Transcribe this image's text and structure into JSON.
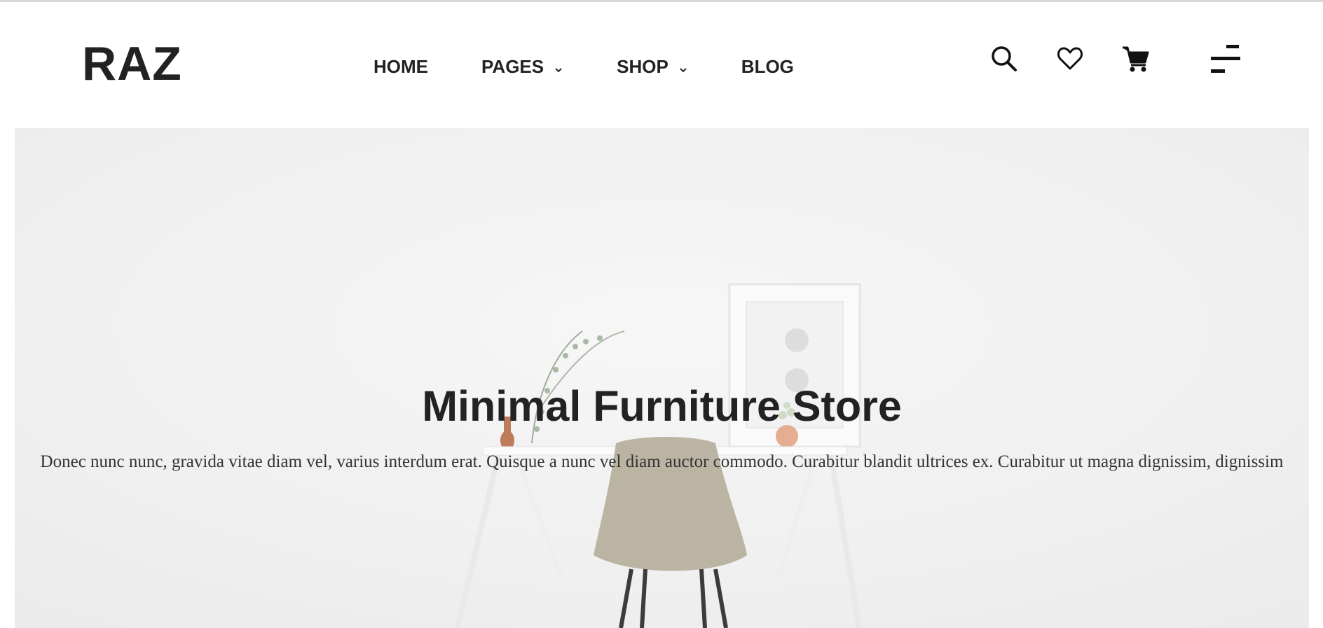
{
  "brand": {
    "logo": "RAZ"
  },
  "nav": {
    "items": [
      {
        "label": "HOME",
        "has_dropdown": false
      },
      {
        "label": "PAGES",
        "has_dropdown": true
      },
      {
        "label": "SHOP",
        "has_dropdown": true
      },
      {
        "label": "BLOG",
        "has_dropdown": false
      }
    ]
  },
  "header_icons": [
    "search-icon",
    "heart-icon",
    "cart-icon",
    "menu-icon"
  ],
  "hero": {
    "title": "Minimal Furniture Store",
    "text": "Donec nunc nunc, gravida vitae diam vel, varius interdum erat. Quisque a nunc vel diam auctor commodo. Curabitur blandit ultrices ex. Curabitur ut magna dignissim, dignissim"
  },
  "colors": {
    "text": "#222222",
    "hero_bg": "#eeeeee",
    "chair": "#b3aa97"
  }
}
